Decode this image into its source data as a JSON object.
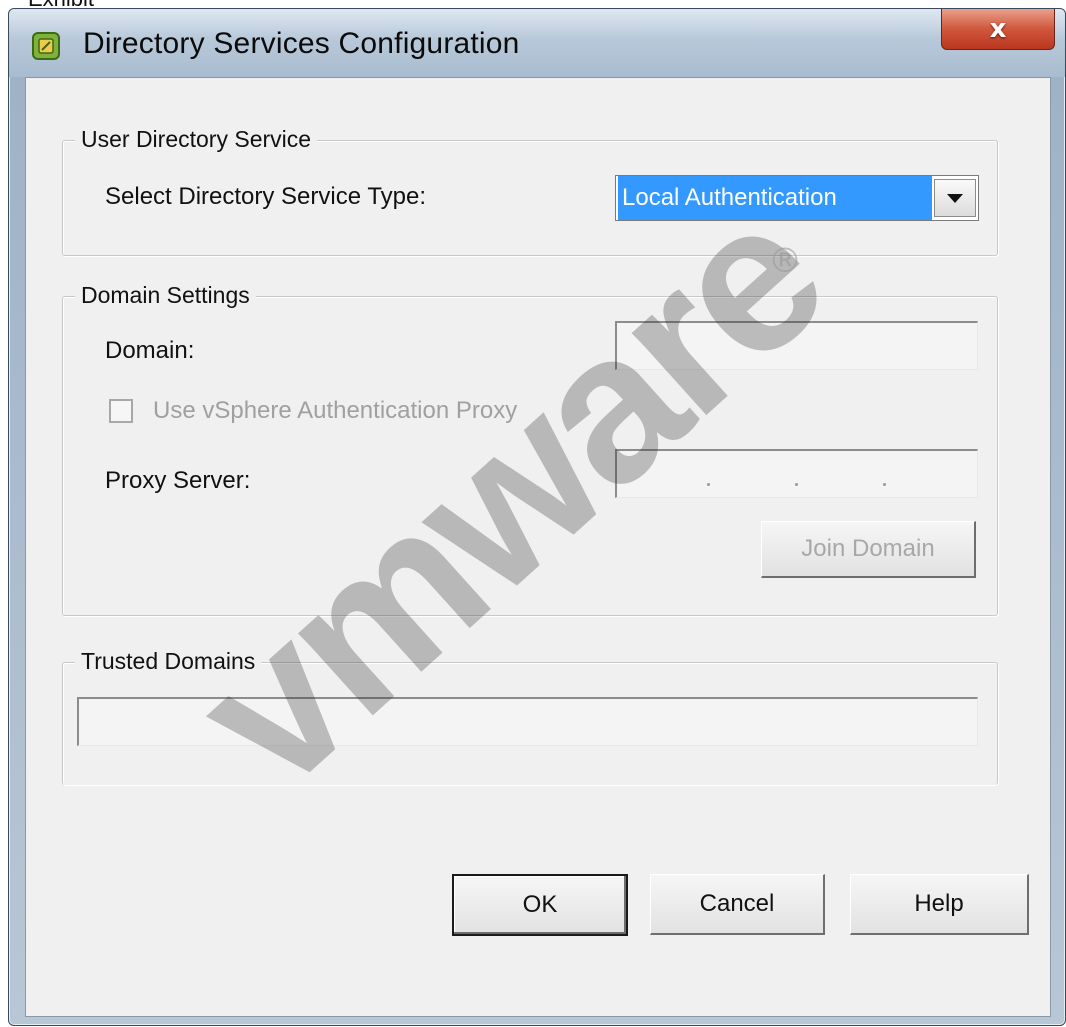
{
  "exhibit_label": "Exhibit",
  "window": {
    "title": "Directory Services Configuration",
    "close_label": "x"
  },
  "user_directory_service": {
    "legend": "User Directory Service",
    "type_label": "Select Directory Service Type:",
    "type_value": "Local Authentication"
  },
  "domain_settings": {
    "legend": "Domain Settings",
    "domain_label": "Domain:",
    "domain_value": "",
    "proxy_checkbox_label": "Use vSphere Authentication Proxy",
    "proxy_checkbox_checked": false,
    "proxy_server_label": "Proxy Server:",
    "proxy_server_value": "",
    "join_domain_label": "Join Domain"
  },
  "trusted_domains": {
    "legend": "Trusted Domains",
    "value": ""
  },
  "buttons": {
    "ok": "OK",
    "cancel": "Cancel",
    "help": "Help"
  },
  "watermark": {
    "text": "vmware",
    "registered_mark": "®"
  },
  "colors": {
    "selection": "#3399ff",
    "close_button": "#c9462c",
    "dialog_bg": "#f0f0f0"
  }
}
